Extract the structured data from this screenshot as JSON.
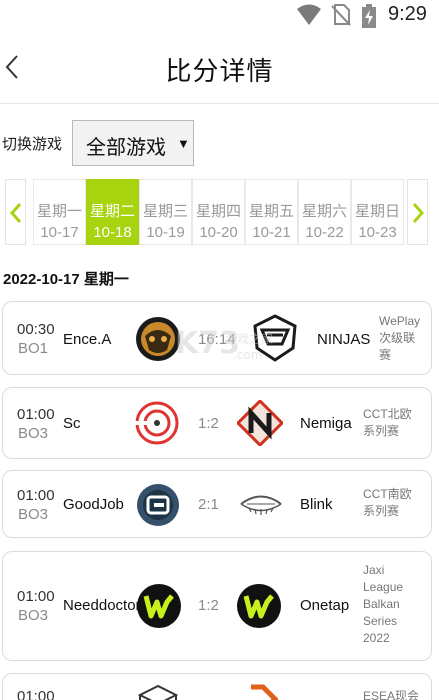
{
  "status_bar": {
    "time": "9:29",
    "icons": [
      "wifi-icon",
      "no-sim-icon",
      "battery-charging-icon"
    ]
  },
  "header": {
    "title": "比分详情",
    "back_icon": "chevron-left-icon"
  },
  "switcher": {
    "label": "切换游戏",
    "selected": "全部游戏",
    "arrow": "▼"
  },
  "week": {
    "prev_icon": "chevron-left-icon",
    "next_icon": "chevron-right-icon",
    "active_color": "#a7d30f",
    "days": [
      {
        "weekday": "星期一",
        "date": "10-17"
      },
      {
        "weekday": "星期二",
        "date": "10-18",
        "active": true
      },
      {
        "weekday": "星期三",
        "date": "10-19"
      },
      {
        "weekday": "星期四",
        "date": "10-20"
      },
      {
        "weekday": "星期五",
        "date": "10-21"
      },
      {
        "weekday": "星期六",
        "date": "10-22"
      },
      {
        "weekday": "星期日",
        "date": "10-23"
      }
    ]
  },
  "date_heading": "2022-10-17 星期一",
  "matches": [
    {
      "time": "00:30",
      "format": "BO1",
      "team_a": "Ence.A",
      "score": "16:14",
      "team_b": "NINJAS",
      "league": [
        "WePlay",
        "次级联",
        "赛"
      ]
    },
    {
      "time": "01:00",
      "format": "BO3",
      "team_a": "Sc",
      "score": "1:2",
      "team_b": "Nemiga",
      "league": [
        "CCT北欧",
        "系列赛"
      ]
    },
    {
      "time": "01:00",
      "format": "BO3",
      "team_a": "GoodJob",
      "score": "2:1",
      "team_b": "Blink",
      "league": [
        "CCT南欧",
        "系列赛"
      ]
    },
    {
      "time": "01:00",
      "format": "BO3",
      "team_a": "Needdoctor",
      "score": "1:2",
      "team_b": "Onetap",
      "league": [
        "Jaxi",
        "League",
        "Balkan",
        "Series",
        "2022"
      ]
    },
    {
      "time": "01:00",
      "format": "",
      "team_a": "",
      "score": "",
      "team_b": "",
      "league": [
        "ESEA现会"
      ]
    }
  ],
  "watermark": {
    "text_main": "K73",
    "text_sub": "游戏之家",
    "text_url": ".com"
  }
}
